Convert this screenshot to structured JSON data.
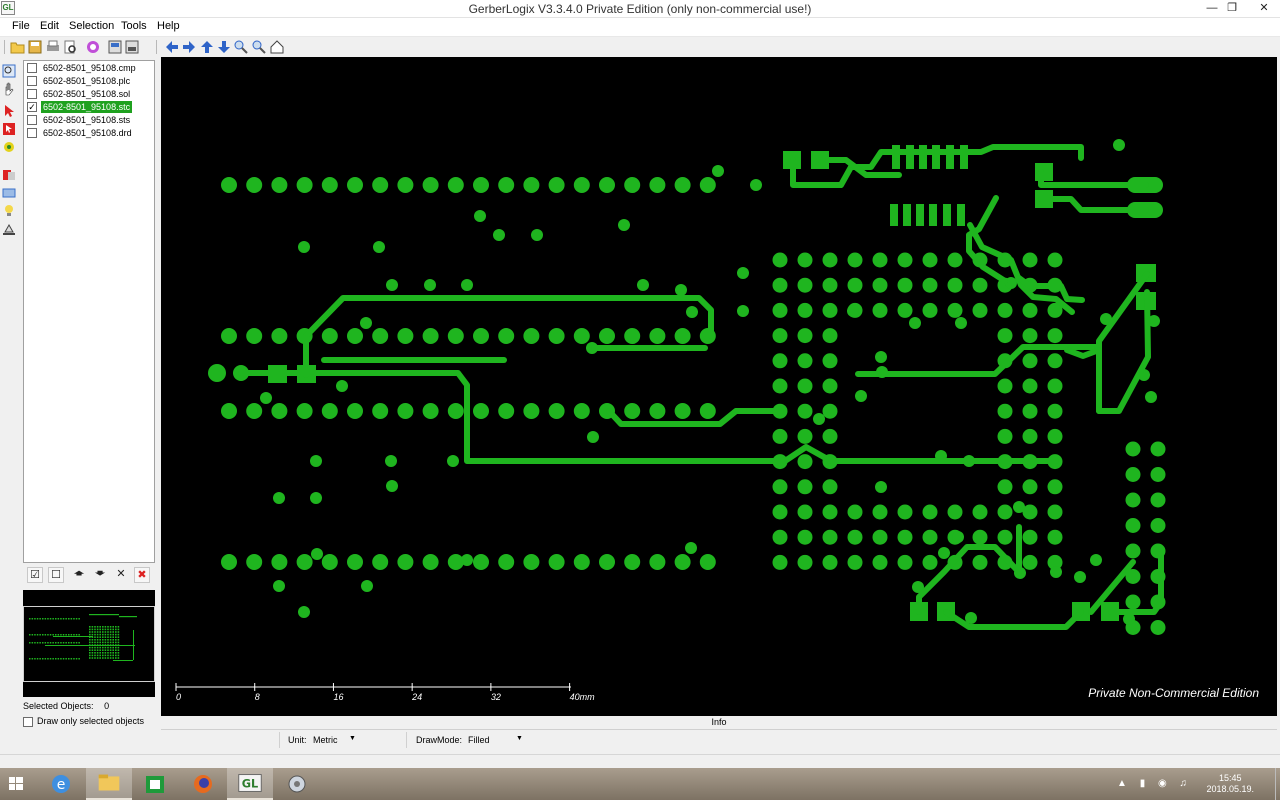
{
  "window": {
    "title": "GerberLogix V3.3.4.0    Private Edition (only non-commercial use!)",
    "app_icon": "GL"
  },
  "menu": [
    "File",
    "Edit",
    "Selection",
    "Tools",
    "Help"
  ],
  "toolbar_icons": [
    "open-icon",
    "save-icon",
    "print-icon",
    "print-preview-icon",
    "color-icon",
    "import-icon",
    "export-icon",
    "pan-left-icon",
    "pan-right-icon",
    "pan-up-icon",
    "pan-down-icon",
    "zoom-in-icon",
    "zoom-out-icon",
    "home-icon"
  ],
  "layers": [
    {
      "name": "6502-8501_95108.cmp",
      "checked": false,
      "selected": false
    },
    {
      "name": "6502-8501_95108.plc",
      "checked": false,
      "selected": false
    },
    {
      "name": "6502-8501_95108.sol",
      "checked": false,
      "selected": false
    },
    {
      "name": "6502-8501_95108.stc",
      "checked": true,
      "selected": true
    },
    {
      "name": "6502-8501_95108.sts",
      "checked": false,
      "selected": false
    },
    {
      "name": "6502-8501_95108.drd",
      "checked": false,
      "selected": false
    }
  ],
  "layer_tools": [
    "check-all-icon",
    "uncheck-all-icon",
    "move-up-icon",
    "move-down-icon",
    "remove-icon",
    "remove-all-icon"
  ],
  "selected_objects": {
    "label": "Selected Objects:",
    "value": "0"
  },
  "draw_only_selected": {
    "label": "Draw only selected objects",
    "checked": false
  },
  "canvas": {
    "pad_color": "#1fb51f",
    "background": "#000000",
    "watermark": "Private Non-Commercial Edition",
    "scale_labels": [
      "0",
      "8",
      "16",
      "24",
      "32",
      "40mm"
    ]
  },
  "info_label": "Info",
  "status": {
    "unit_label": "Unit:",
    "unit_value": "Metric",
    "drawmode_label": "DrawMode:",
    "drawmode_value": "Filled"
  },
  "taskbar": {
    "apps": [
      "windows-start-icon",
      "internet-explorer-icon",
      "file-explorer-icon",
      "store-icon",
      "firefox-icon",
      "gerberlogix-icon",
      "settings-icon"
    ],
    "time": "15:45",
    "date": "2018.05.19."
  }
}
